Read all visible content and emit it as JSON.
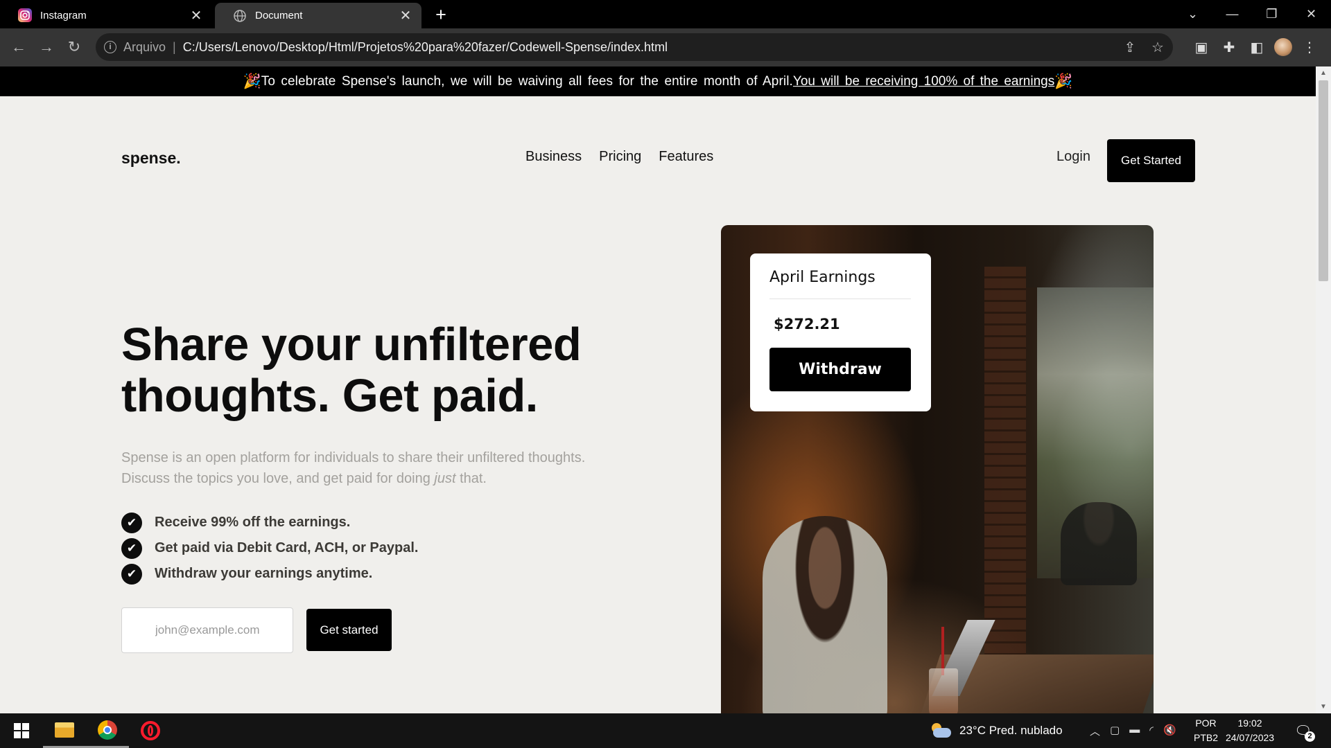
{
  "browser": {
    "tabs": [
      {
        "title": "Instagram",
        "icon": "instagram-icon",
        "active": false
      },
      {
        "title": "Document",
        "icon": "globe-icon",
        "active": true
      }
    ],
    "address": {
      "scheme_label": "Arquivo",
      "url": "C:/Users/Lenovo/Desktop/Html/Projetos%20para%20fazer/Codewell-Spense/index.html"
    }
  },
  "page": {
    "banner": {
      "text": "To celebrate Spense's launch, we will be waiving all fees for the entire month of April.",
      "link": "You will be receiving 100% of the earnings"
    },
    "header": {
      "logo": "spense.",
      "nav": [
        "Business",
        "Pricing",
        "Features"
      ],
      "login": "Login",
      "cta": "Get Started"
    },
    "hero": {
      "title_line1": "Share your unfiltered",
      "title_line2": "thoughts. Get paid.",
      "desc_part1": "Spense is an open platform for individuals to share their unfiltered thoughts.",
      "desc_part2": "Discuss the topics you love, and get paid for doing ",
      "desc_em": "just",
      "desc_part3": " that.",
      "features": [
        "Receive 99% off the earnings.",
        "Get paid via Debit Card, ACH, or Paypal.",
        "Withdraw your earnings anytime."
      ],
      "email_placeholder": "john@example.com",
      "cta": "Get started"
    },
    "earnings_card": {
      "title": "April Earnings",
      "amount": "$272.21",
      "button": "Withdraw"
    }
  },
  "taskbar": {
    "weather": "23°C  Pred. nublado",
    "lang_line1": "POR",
    "lang_line2": "PTB2",
    "time": "19:02",
    "date": "24/07/2023",
    "notifications": "2"
  },
  "colors": {
    "page_bg": "#f0efec",
    "accent": "#000000",
    "muted_text": "#a3a19d"
  }
}
